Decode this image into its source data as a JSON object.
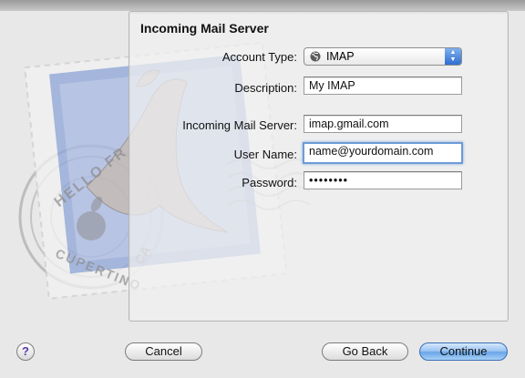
{
  "panel": {
    "title": "Incoming Mail Server"
  },
  "form": {
    "account_type_label": "Account Type:",
    "account_type_value": "IMAP",
    "description_label": "Description:",
    "description_value": "My IMAP",
    "server_label": "Incoming Mail Server:",
    "server_value": "imap.gmail.com",
    "username_label": "User Name:",
    "username_value": "name@yourdomain.com",
    "password_label": "Password:",
    "password_value": "••••••••"
  },
  "background_stamp": {
    "text_top": "HELLO FR",
    "text_bottom": "CUPERTINO",
    "text_side": "CA"
  },
  "buttons": {
    "help": "?",
    "cancel": "Cancel",
    "go_back": "Go Back",
    "continue": "Continue"
  },
  "icons": {
    "globe": "globe-icon",
    "popup_arrows": "up-down-arrows-icon",
    "stamp": "mail-stamp-illustration"
  },
  "colors": {
    "focus_ring": "#6d9bd6",
    "default_button": "#6aa6e9",
    "help_glyph": "#5a3aa8"
  }
}
